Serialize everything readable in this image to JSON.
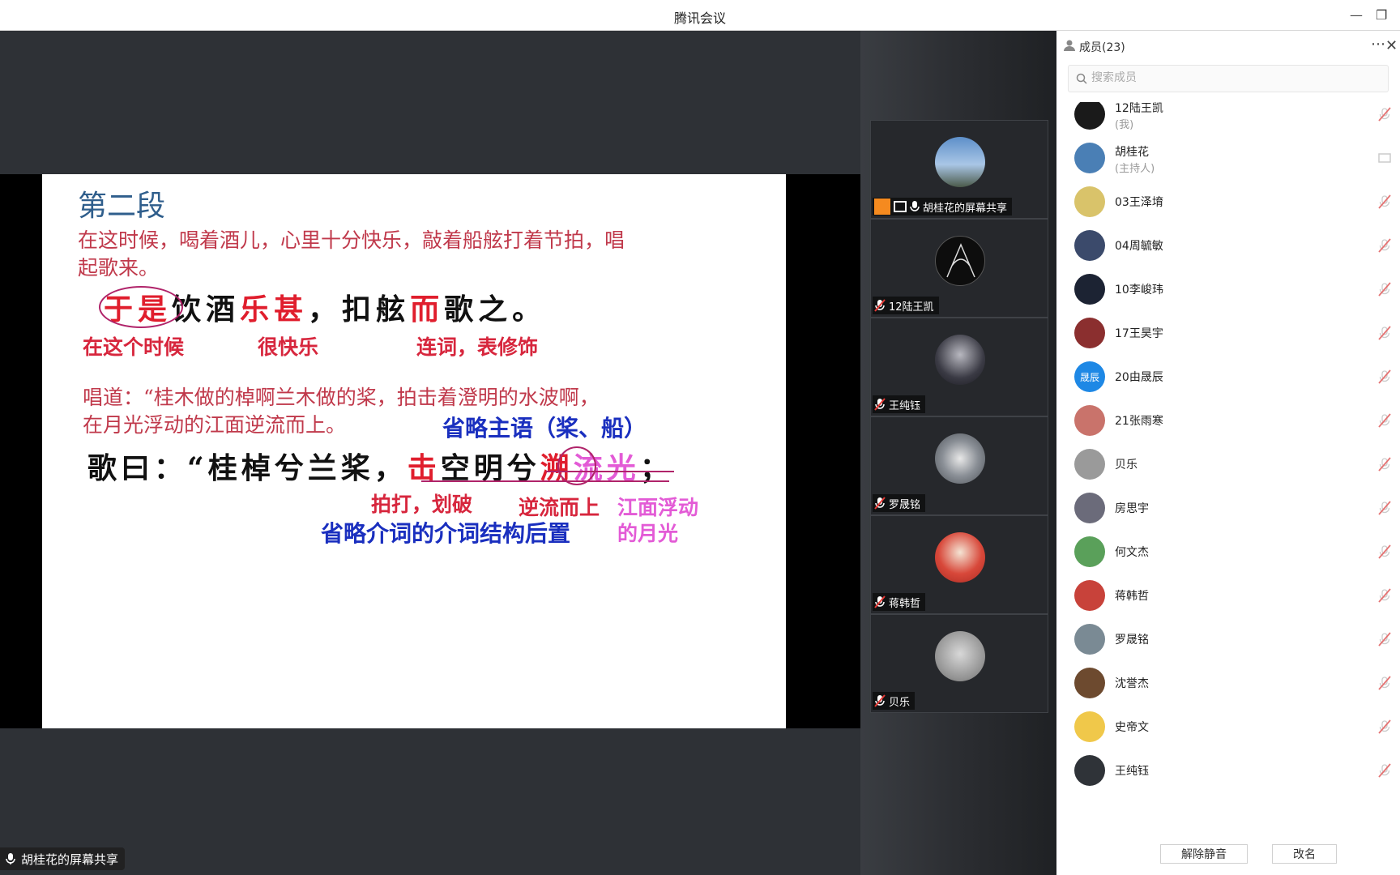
{
  "window": {
    "title": "腾讯会议"
  },
  "slide": {
    "heading": "第二段",
    "para1_line1": "在这时候，喝着酒儿，心里十分快乐，敲着船舷打着节拍，唱",
    "para1_line2": "起歌来。",
    "s1": [
      "于是",
      "饮酒",
      "乐甚",
      "，扣舷",
      "而",
      "歌之。"
    ],
    "s1_notes": {
      "a": "在这个时候",
      "b": "很快乐",
      "c": "连词，表修饰"
    },
    "para2_line1": "唱道：“桂木做的棹啊兰木做的桨，拍击着澄明的水波啊，",
    "para2_line2": "在月光浮动的江面逆流而上。",
    "note_omit_subject": "省略主语（桨、船）",
    "s2": [
      "歌曰：“桂棹兮兰桨，",
      "击",
      "空明兮",
      "溯",
      "流光",
      "；"
    ],
    "s2_notes": {
      "a": "拍打，划破",
      "b": "逆流而上",
      "c": "江面浮动",
      "d": "的月光",
      "e": "省略介词的介词结构后置"
    }
  },
  "stage": {
    "share_label": "胡桂花的屏幕共享"
  },
  "tiles": [
    {
      "label": "胡桂花的屏幕共享"
    },
    {
      "label": "12陆王凯"
    },
    {
      "label": "王纯钰"
    },
    {
      "label": "罗晟铭"
    },
    {
      "label": "蒋韩哲"
    },
    {
      "label": "贝乐"
    }
  ],
  "members": {
    "header": "成员(23)",
    "search_placeholder": "搜索成员",
    "items": [
      {
        "name": "12陆王凯",
        "role": "(我)",
        "color": "#1a1a1a"
      },
      {
        "name": "胡桂花",
        "role": "(主持人)",
        "color": "#4a7fb5"
      },
      {
        "name": "03王泽堉",
        "role": "",
        "color": "#d9c36a"
      },
      {
        "name": "04周毓敏",
        "role": "",
        "color": "#3b4a6b"
      },
      {
        "name": "10李峻玮",
        "role": "",
        "color": "#1c2333"
      },
      {
        "name": "17王昊宇",
        "role": "",
        "color": "#8b2f2f"
      },
      {
        "name": "20由晟辰",
        "role": "",
        "color": "#1e88e5",
        "initials": "晟辰"
      },
      {
        "name": "21张雨寒",
        "role": "",
        "color": "#c9736b"
      },
      {
        "name": "贝乐",
        "role": "",
        "color": "#9a9a9a"
      },
      {
        "name": "房思宇",
        "role": "",
        "color": "#6b6b7a"
      },
      {
        "name": "何文杰",
        "role": "",
        "color": "#5aa05a"
      },
      {
        "name": "蒋韩哲",
        "role": "",
        "color": "#c8423a"
      },
      {
        "name": "罗晟铭",
        "role": "",
        "color": "#7a8a94"
      },
      {
        "name": "沈誉杰",
        "role": "",
        "color": "#6d4a2f"
      },
      {
        "name": "史帝文",
        "role": "",
        "color": "#f0c84a"
      },
      {
        "name": "王纯钰",
        "role": "",
        "color": "#2f3338"
      }
    ],
    "unmute_label": "解除静音",
    "rename_label": "改名"
  }
}
